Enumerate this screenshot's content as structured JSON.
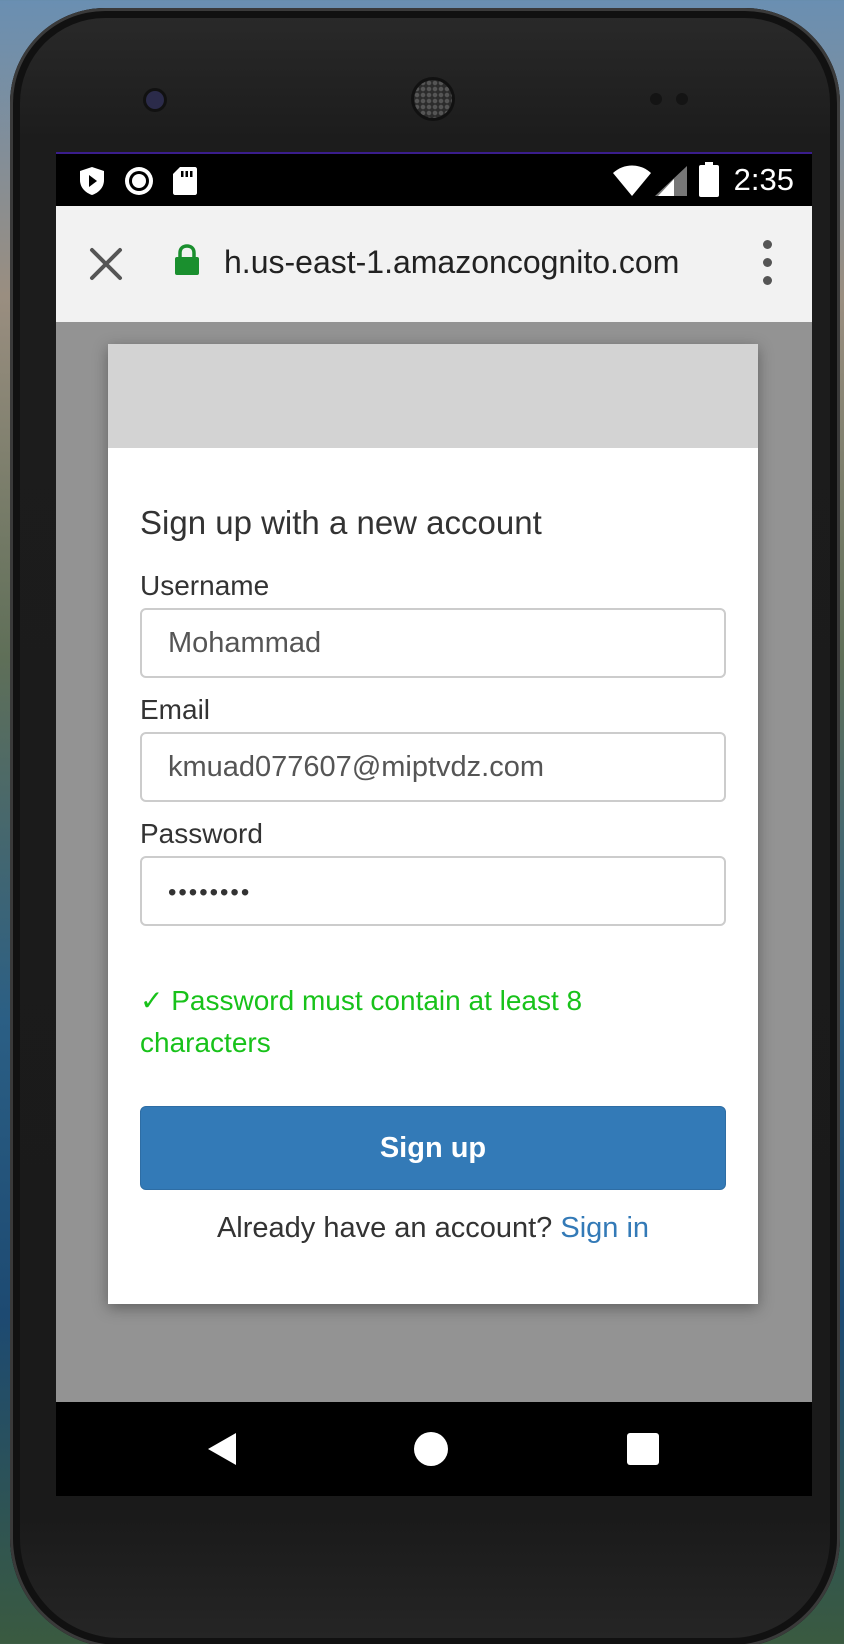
{
  "status_bar": {
    "time": "2:35",
    "left_icons": [
      "shield-icon",
      "record-icon",
      "sd-card-icon"
    ],
    "right_icons": [
      "wifi-icon",
      "signal-icon",
      "battery-icon"
    ]
  },
  "browser": {
    "url": "h.us-east-1.amazoncognito.com",
    "close_icon": "close-icon",
    "lock_icon": "lock-icon",
    "menu_icon": "more-vert-icon",
    "lock_color": "#1a8f2e"
  },
  "form": {
    "title": "Sign up with a new account",
    "username_label": "Username",
    "username_value": "Mohammad",
    "email_label": "Email",
    "email_value": "kmuad077607@miptvdz.com",
    "password_label": "Password",
    "password_value": "••••••••",
    "password_hint_check": "✓",
    "password_hint": "Password must contain at least 8 characters",
    "submit_label": "Sign up",
    "footer_text": "Already have an account?",
    "signin_link": "Sign in"
  },
  "colors": {
    "primary": "#337ab7",
    "success": "#18c21a",
    "header_gray": "#d3d3d3",
    "page_bg": "#939393"
  },
  "nav_bar": {
    "icons": [
      "back-icon",
      "home-icon",
      "recents-icon"
    ]
  }
}
